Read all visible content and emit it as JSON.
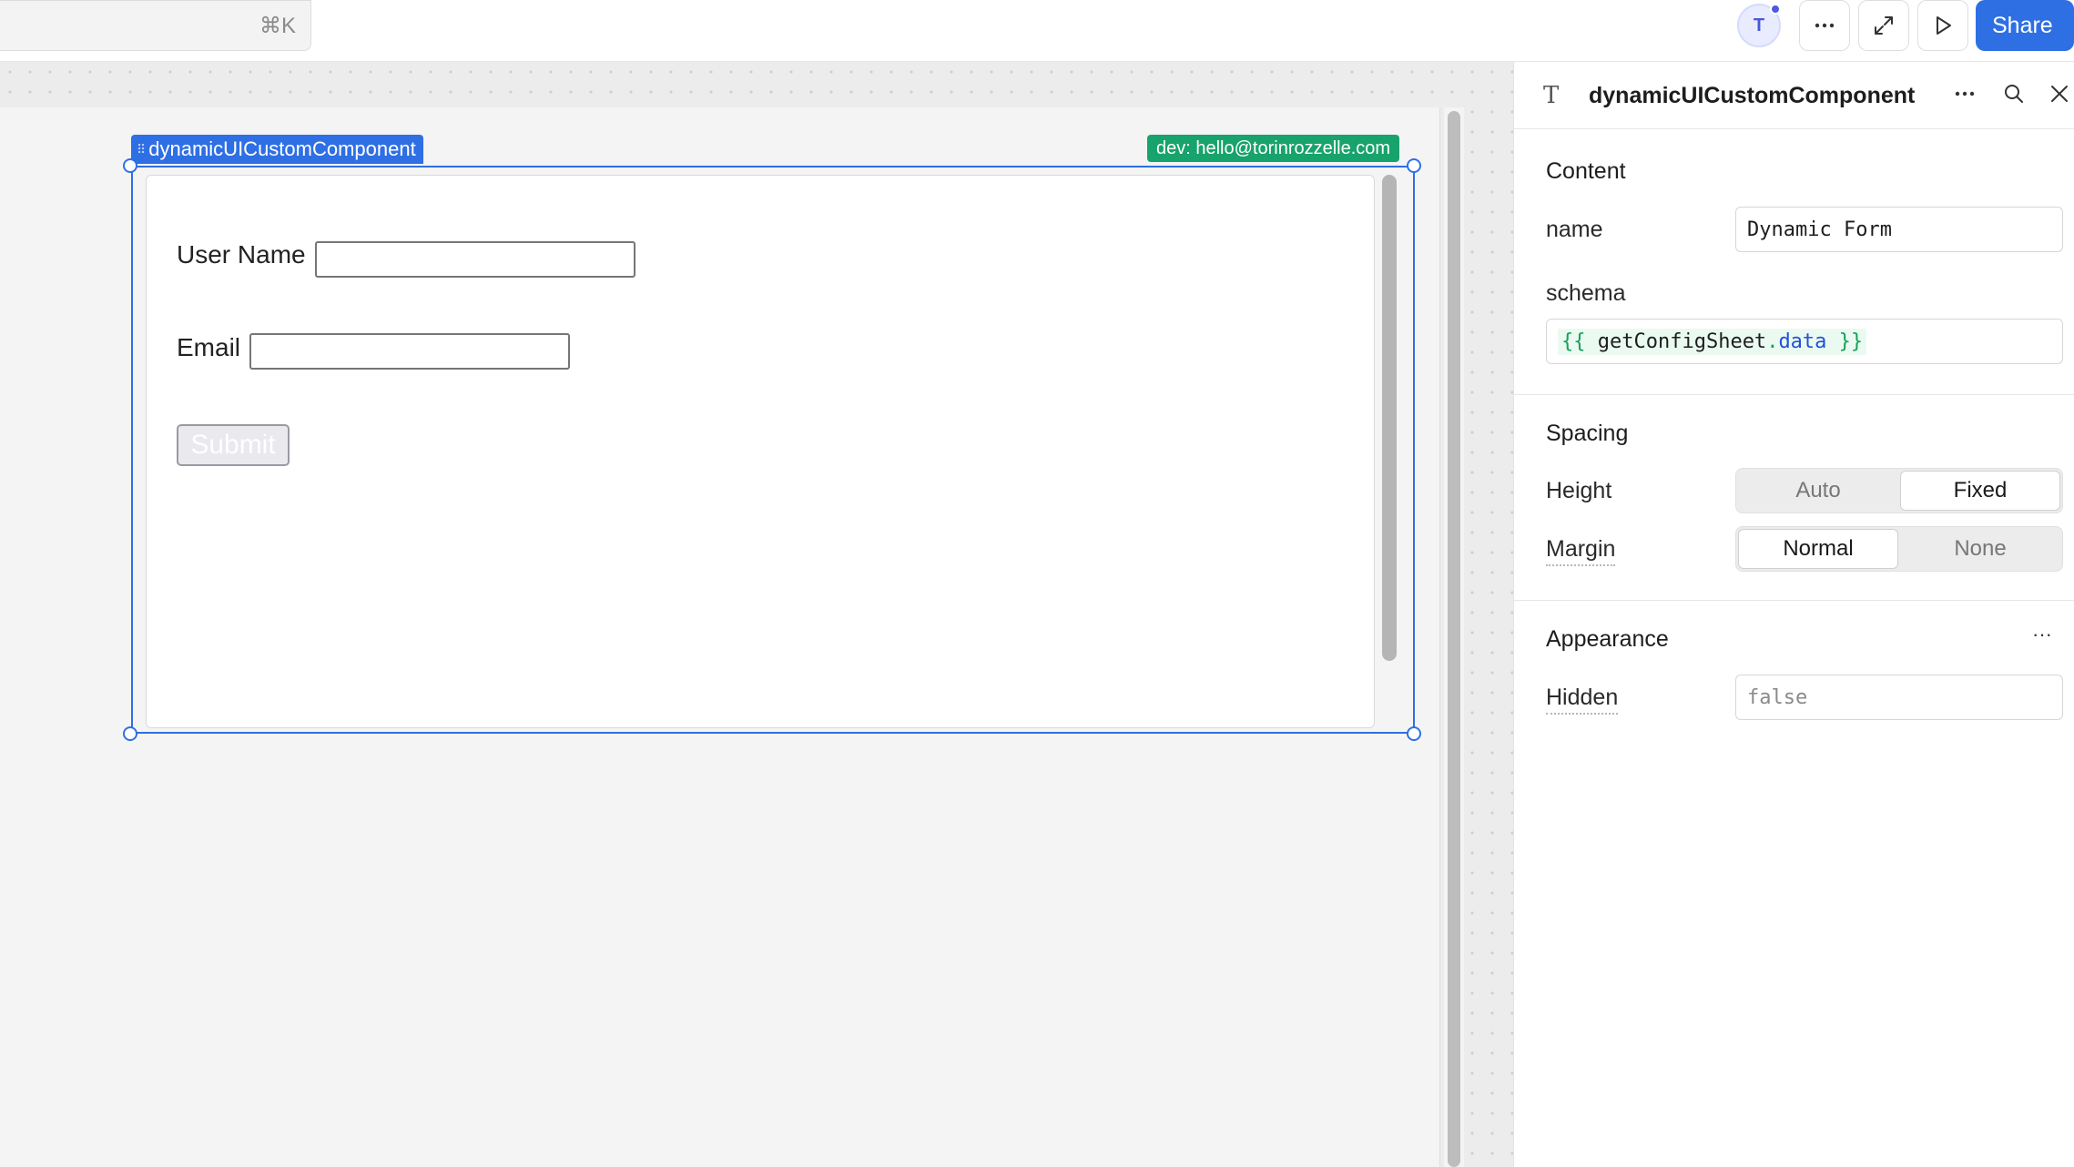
{
  "topbar": {
    "search_shortcut": "⌘K",
    "avatar_initial": "T",
    "share_label": "Share"
  },
  "canvas": {
    "component_tag": "dynamicUICustomComponent",
    "dev_tag": "dev: hello@torinrozzelle.com",
    "form": {
      "username_label": "User Name",
      "email_label": "Email",
      "submit_label": "Submit"
    }
  },
  "inspector": {
    "title": "dynamicUICustomComponent",
    "content": {
      "heading": "Content",
      "name_label": "name",
      "name_value": "Dynamic Form",
      "schema_label": "schema",
      "schema_open": "{{",
      "schema_object": "getConfigSheet",
      "schema_dot": ".",
      "schema_property": "data",
      "schema_close": "}}"
    },
    "spacing": {
      "heading": "Spacing",
      "height_label": "Height",
      "height_options": [
        "Auto",
        "Fixed"
      ],
      "height_selected": "Fixed",
      "margin_label": "Margin",
      "margin_options": [
        "Normal",
        "None"
      ],
      "margin_selected": "Normal"
    },
    "appearance": {
      "heading": "Appearance",
      "more_label": "···",
      "hidden_label": "Hidden",
      "hidden_value": "false"
    }
  },
  "colors": {
    "accent": "#2f6fe4",
    "dev_badge": "#17a36b",
    "code_green": "#16a05c",
    "code_blue": "#2450d8"
  },
  "icons": [
    "search-icon",
    "more-icon",
    "expand-icon",
    "play-icon",
    "text-type-icon",
    "close-icon",
    "drag-grip-icon"
  ]
}
